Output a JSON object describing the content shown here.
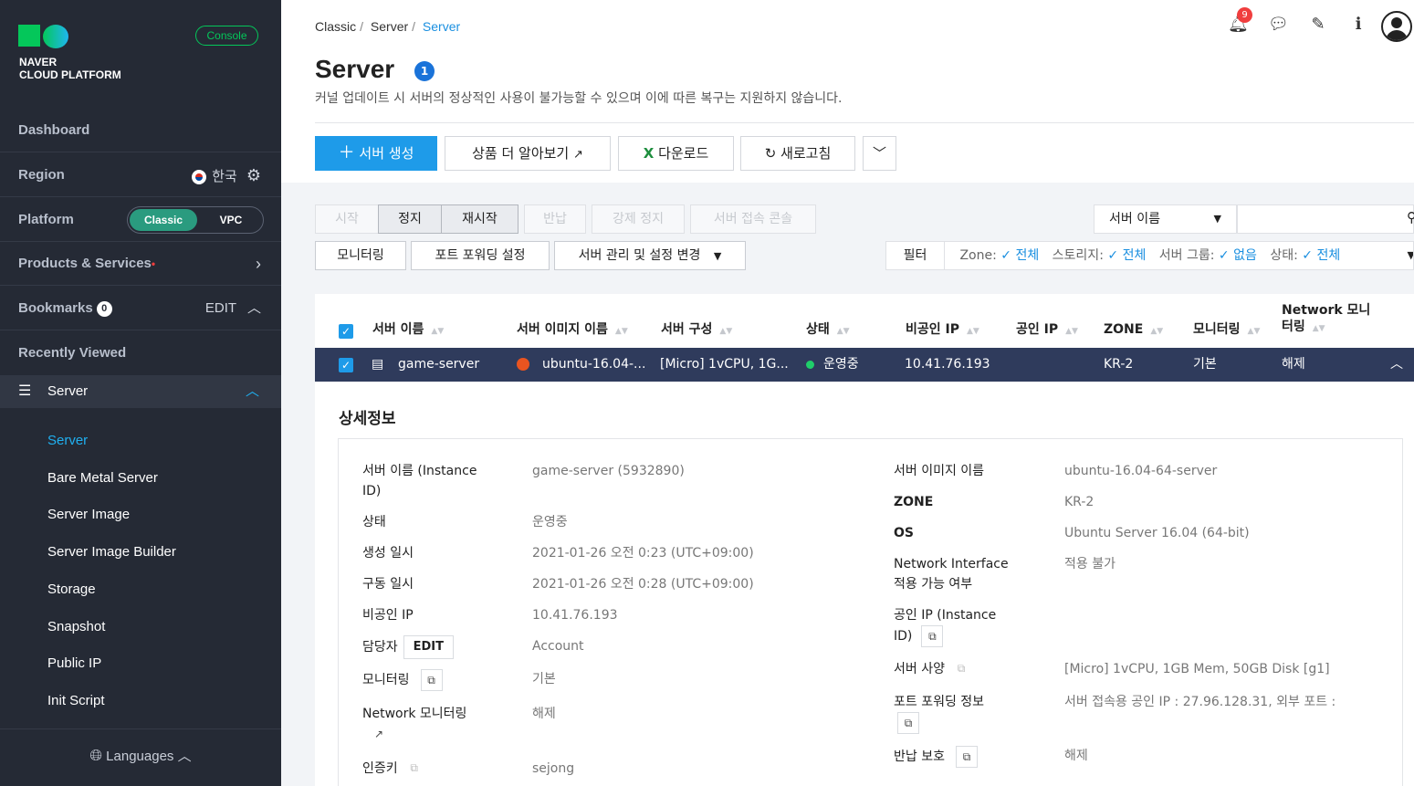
{
  "brand": {
    "line1": "NAVER",
    "line2": "CLOUD PLATFORM",
    "console": "Console"
  },
  "sidebar": {
    "dashboard": "Dashboard",
    "region_label": "Region",
    "region_value": "한국",
    "platform_label": "Platform",
    "platform_on": "Classic",
    "platform_off": "VPC",
    "products": "Products & Services",
    "bookmarks": "Bookmarks",
    "bookmarks_count": "0",
    "bookmarks_edit": "EDIT",
    "recent": "Recently Viewed",
    "server_section": "Server",
    "items": [
      "Server",
      "Bare Metal Server",
      "Server Image",
      "Server Image Builder",
      "Storage",
      "Snapshot",
      "Public IP",
      "Init Script"
    ],
    "languages": "Languages"
  },
  "header": {
    "crumbs": [
      "Classic",
      "Server",
      "Server"
    ],
    "notif_count": "9",
    "title": "Server",
    "title_badge": "1",
    "subtitle": "커널 업데이트 시 서버의 정상적인 사용이 불가능할 수 있으며 이에 따른 복구는 지원하지 않습니다."
  },
  "toolbar": {
    "create": "서버 생성",
    "learn": "상품 더 알아보기",
    "download": "다운로드",
    "refresh": "새로고침"
  },
  "actions": {
    "start": "시작",
    "stop": "정지",
    "restart": "재시작",
    "return": "반납",
    "force_stop": "강제 정지",
    "console": "서버 접속 콘솔",
    "monitoring": "모니터링",
    "port_forward": "포트 포워딩 설정",
    "manage": "서버 관리 및 설정 변경"
  },
  "search": {
    "select": "서버 이름"
  },
  "filter": {
    "label": "필터",
    "zone_k": "Zone:",
    "zone_v": "전체",
    "storage_k": "스토리지:",
    "storage_v": "전체",
    "group_k": "서버 그룹:",
    "group_v": "없음",
    "status_k": "상태:",
    "status_v": "전체"
  },
  "table": {
    "columns": [
      "서버 이름",
      "서버 이미지 이름",
      "서버 구성",
      "상태",
      "비공인 IP",
      "공인 IP",
      "ZONE",
      "모니터링",
      "Network 모니",
      "터링"
    ],
    "row": {
      "name": "game-server",
      "image": "ubuntu-16.04-...",
      "spec": "[Micro] 1vCPU, 1G...",
      "status": "운영중",
      "private_ip": "10.41.76.193",
      "public_ip": "",
      "zone": "KR-2",
      "monitoring": "기본",
      "net_monitoring": "해제"
    }
  },
  "detail": {
    "title": "상세정보",
    "left": [
      {
        "k": "서버 이름 (Instance",
        "k2": "ID)",
        "v": "game-server (5932890)"
      },
      {
        "k": "상태",
        "v": "운영중"
      },
      {
        "k": "생성 일시",
        "v": "2021-01-26 오전 0:23 (UTC+09:00)"
      },
      {
        "k": "구동 일시",
        "v": "2021-01-26 오전 0:28 (UTC+09:00)"
      },
      {
        "k": "비공인 IP",
        "v": "10.41.76.193"
      },
      {
        "k": "담당자",
        "btn": "EDIT",
        "v": "Account"
      },
      {
        "k": "모니터링",
        "v": "기본"
      },
      {
        "k": "Network 모니터링",
        "v": "해제"
      },
      {
        "k": "인증키",
        "v": "sejong"
      }
    ],
    "right": [
      {
        "k": "서버 이미지 이름",
        "v": "ubuntu-16.04-64-server"
      },
      {
        "k": "ZONE",
        "v": "KR-2"
      },
      {
        "k": "OS",
        "v": "Ubuntu Server 16.04 (64-bit)"
      },
      {
        "k": "Network Interface",
        "k2": "적용 가능 여부",
        "v": "적용 불가"
      },
      {
        "k": "공인 IP (Instance",
        "k2": "ID)",
        "v": ""
      },
      {
        "k": "서버 사양",
        "v": "[Micro] 1vCPU, 1GB Mem, 50GB Disk [g1]"
      },
      {
        "k": "포트 포워딩 정보",
        "v": "서버 접속용 공인 IP : 27.96.128.31, 외부 포트 :"
      },
      {
        "k": "반납 보호",
        "v": "해제"
      }
    ]
  }
}
